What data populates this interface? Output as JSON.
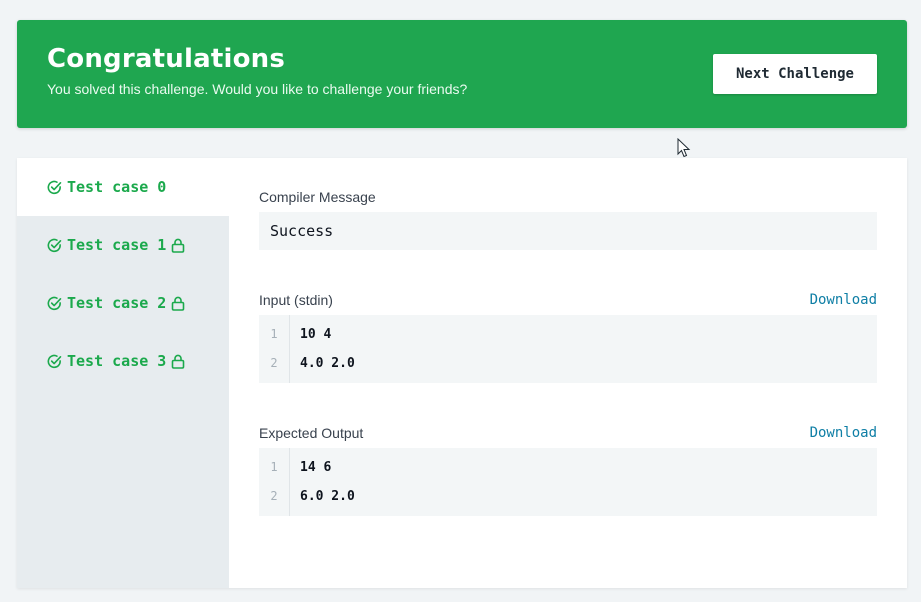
{
  "banner": {
    "title": "Congratulations",
    "subtitle": "You solved this challenge. Would you like to challenge your friends?",
    "button_label": "Next Challenge",
    "color": "#1fa650"
  },
  "sidebar": {
    "items": [
      {
        "label": "Test case 0",
        "icon": "check-circle-icon",
        "locked": false,
        "active": true
      },
      {
        "label": "Test case 1",
        "icon": "check-circle-icon",
        "locked": true,
        "active": false
      },
      {
        "label": "Test case 2",
        "icon": "check-circle-icon",
        "locked": true,
        "active": false
      },
      {
        "label": "Test case 3",
        "icon": "check-circle-icon",
        "locked": true,
        "active": false
      }
    ]
  },
  "compiler": {
    "label": "Compiler Message",
    "message": "Success"
  },
  "input": {
    "label": "Input (stdin)",
    "download": "Download",
    "lines": [
      {
        "n": "1",
        "text": "10 4"
      },
      {
        "n": "2",
        "text": "4.0 2.0"
      }
    ]
  },
  "expected": {
    "label": "Expected Output",
    "download": "Download",
    "lines": [
      {
        "n": "1",
        "text": "14 6"
      },
      {
        "n": "2",
        "text": "6.0 2.0"
      }
    ]
  },
  "colors": {
    "accent_green": "#1ba94c",
    "link_blue": "#0e7ea5"
  }
}
